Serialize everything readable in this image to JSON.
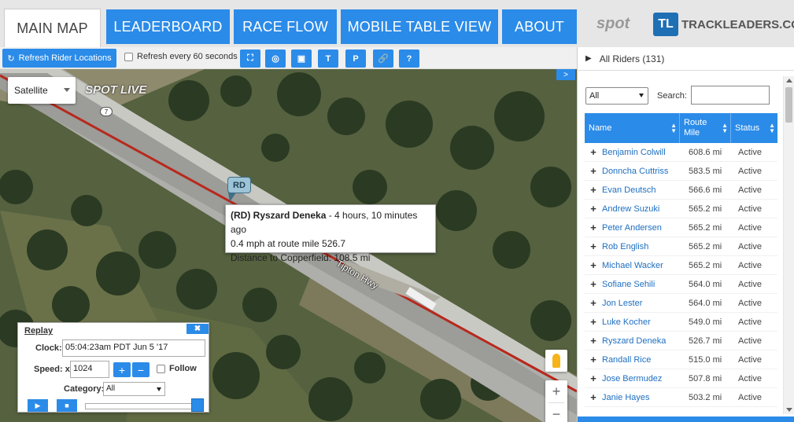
{
  "nav": {
    "tabs": [
      {
        "label": "MAIN MAP",
        "active": true
      },
      {
        "label": "LEADERBOARD"
      },
      {
        "label": "RACE FLOW"
      },
      {
        "label": "MOBILE TABLE VIEW"
      },
      {
        "label": "ABOUT"
      }
    ],
    "spot_logo": "spot",
    "tl_logo_mark": "TL",
    "tl_logo_text": "TRACKLEADERS.COM"
  },
  "toolbar": {
    "refresh_label": "Refresh Rider Locations",
    "auto_refresh_label": "Refresh every 60 seconds",
    "auto_refresh_checked": false,
    "tools": [
      {
        "icon": "fullscreen-icon",
        "glyph": "⛶"
      },
      {
        "icon": "user-icon",
        "glyph": "◎"
      },
      {
        "icon": "image-icon",
        "glyph": "▣"
      },
      {
        "icon": "text-icon",
        "glyph": "T"
      },
      {
        "icon": "parking-icon",
        "glyph": "P"
      },
      {
        "icon": "link-icon",
        "glyph": "🔗"
      },
      {
        "icon": "help-icon",
        "glyph": "?"
      }
    ]
  },
  "map": {
    "map_type": "Satellite",
    "spot_live_label": "SPOT LIVE",
    "route_shield": "7",
    "marker_label": "RD",
    "road_label": "Tipton Hwy",
    "expand_glyph": ">",
    "popup": {
      "rider_code": "(RD) Ryszard Deneka",
      "time_ago": " - 4 hours, 10 minutes ago",
      "speed_line": "0.4 mph at route mile 526.7",
      "distance_line": "Distance to Copperfield: 108.5 mi"
    },
    "zoom_in": "+",
    "zoom_out": "−"
  },
  "replay": {
    "title": "Replay",
    "close": "✖",
    "clock_label": "Clock:",
    "clock_value": "05:04:23am PDT Jun 5 '17",
    "speed_label": "Speed: x",
    "speed_value": "1024",
    "plus": "+",
    "minus": "−",
    "follow_label": "Follow",
    "category_label": "Category:",
    "category_value": "All",
    "play": "▶",
    "stop": "■",
    "progress": 0.99
  },
  "riders_panel": {
    "header": "All Riders (131)",
    "filter_value": "All",
    "search_label": "Search:",
    "search_value": "",
    "columns": [
      "Name",
      "Route Mile",
      "Status"
    ],
    "rows": [
      {
        "name": "Benjamin Colwill",
        "mile": "608.6 mi",
        "status": "Active"
      },
      {
        "name": "Donncha Cuttriss",
        "mile": "583.5 mi",
        "status": "Active"
      },
      {
        "name": "Evan Deutsch",
        "mile": "566.6 mi",
        "status": "Active"
      },
      {
        "name": "Andrew Suzuki",
        "mile": "565.2 mi",
        "status": "Active"
      },
      {
        "name": "Peter Andersen",
        "mile": "565.2 mi",
        "status": "Active"
      },
      {
        "name": "Rob English",
        "mile": "565.2 mi",
        "status": "Active"
      },
      {
        "name": "Michael Wacker",
        "mile": "565.2 mi",
        "status": "Active"
      },
      {
        "name": "Sofiane Sehili",
        "mile": "564.0 mi",
        "status": "Active"
      },
      {
        "name": "Jon Lester",
        "mile": "564.0 mi",
        "status": "Active"
      },
      {
        "name": "Luke Kocher",
        "mile": "549.0 mi",
        "status": "Active"
      },
      {
        "name": "Ryszard Deneka",
        "mile": "526.7 mi",
        "status": "Active"
      },
      {
        "name": "Randall Rice",
        "mile": "515.0 mi",
        "status": "Active"
      },
      {
        "name": "Jose Bermudez",
        "mile": "507.8 mi",
        "status": "Active"
      },
      {
        "name": "Janie Hayes",
        "mile": "503.2 mi",
        "status": "Active"
      }
    ]
  }
}
